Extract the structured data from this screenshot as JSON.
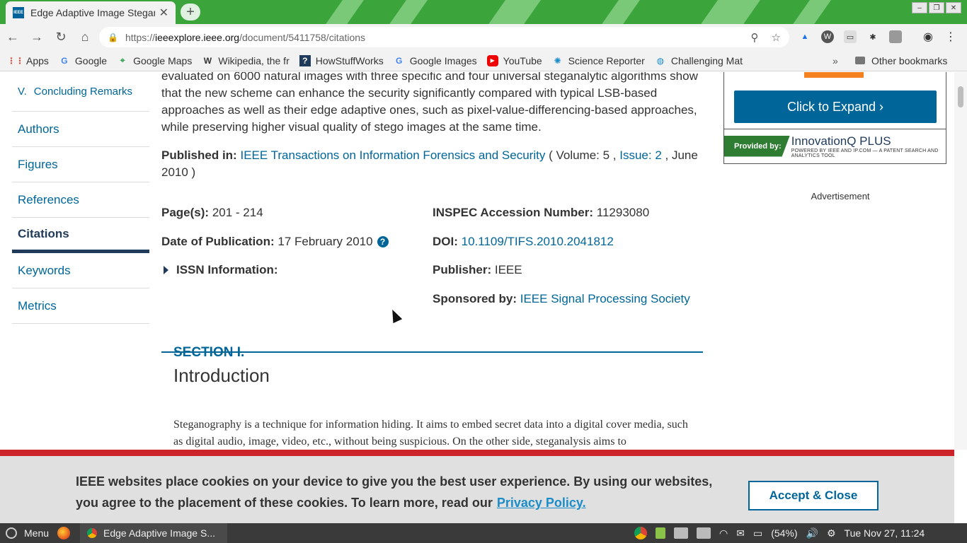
{
  "browser": {
    "tab_title": "Edge Adaptive Image Steganography",
    "url_scheme": "https://",
    "url_host": "ieeexplore.ieee.org",
    "url_path": "/document/5411758/citations",
    "favicon_text": "IEEE"
  },
  "bookmarks": [
    {
      "label": "Apps",
      "icon": "apps-grid-icon"
    },
    {
      "label": "Google",
      "icon": "google-icon"
    },
    {
      "label": "Google Maps",
      "icon": "maps-icon"
    },
    {
      "label": "Wikipedia, the fr",
      "icon": "wikipedia-icon"
    },
    {
      "label": "HowStuffWorks",
      "icon": "howstuffworks-icon"
    },
    {
      "label": "Google Images",
      "icon": "google-icon"
    },
    {
      "label": "YouTube",
      "icon": "youtube-icon"
    },
    {
      "label": "Science Reporter",
      "icon": "science-icon"
    },
    {
      "label": "Challenging Mat",
      "icon": "globe-icon"
    }
  ],
  "bookmarks_other": "Other bookmarks",
  "sidenav": {
    "sub_item_num": "V.",
    "sub_item_label": "Concluding Remarks",
    "items": [
      "Authors",
      "Figures",
      "References",
      "Citations",
      "Keywords",
      "Metrics"
    ],
    "active": "Citations"
  },
  "article": {
    "abstract_tail": "evaluated on 6000 natural images with three specific and four universal steganalytic algorithms show that the new scheme can enhance the security significantly compared with typical LSB-based approaches as well as their edge adaptive ones, such as pixel-value-differencing-based approaches, while preserving higher visual quality of stego images at the same time.",
    "published_in_label": "Published in:",
    "journal": "IEEE Transactions on Information Forensics and Security",
    "volume_text": "( Volume: 5 ,",
    "issue": "Issue: 2",
    "date_text": ", June 2010 )",
    "pages_label": "Page(s):",
    "pages": "201 - 214",
    "date_pub_label": "Date of Publication:",
    "date_pub": "17 February 2010",
    "help_glyph": "?",
    "issn_label": "ISSN Information:",
    "inspec_label": "INSPEC Accession Number:",
    "inspec": "11293080",
    "doi_label": "DOI:",
    "doi": "10.1109/TIFS.2010.2041812",
    "publisher_label": "Publisher:",
    "publisher": "IEEE",
    "sponsor_label": "Sponsored by:",
    "sponsor": "IEEE Signal Processing Society"
  },
  "section": {
    "label": "SECTION I.",
    "title": "Introduction",
    "body": "Steganography is a technique for information hiding. It aims to embed secret data into a digital cover media, such as digital audio, image, video, etc., without being suspicious. On the other side, steganalysis aims to"
  },
  "sidebar": {
    "expand_label": "Click to Expand",
    "provided_by": "Provided by:",
    "brand_name": "InnovationQ PLUS",
    "brand_tagline": "POWERED BY IEEE AND IP.COM — A PATENT SEARCH AND ANALYTICS TOOL",
    "ad_label": "Advertisement"
  },
  "cookie": {
    "message": "IEEE websites place cookies on your device to give you the best user experience. By using our websites, you agree to the placement of these cookies. To learn more, read our",
    "link": "Privacy Policy.",
    "button": "Accept & Close",
    "accent_color": "#cc2229"
  },
  "taskbar": {
    "menu_label": "Menu",
    "task_title": "Edge Adaptive Image S...",
    "battery": "(54%)",
    "clock": "Tue Nov 27, 11:24"
  },
  "colors": {
    "link": "#006699",
    "brand_navy": "#1f3a5a",
    "chrome_green": "#3ba43b"
  }
}
